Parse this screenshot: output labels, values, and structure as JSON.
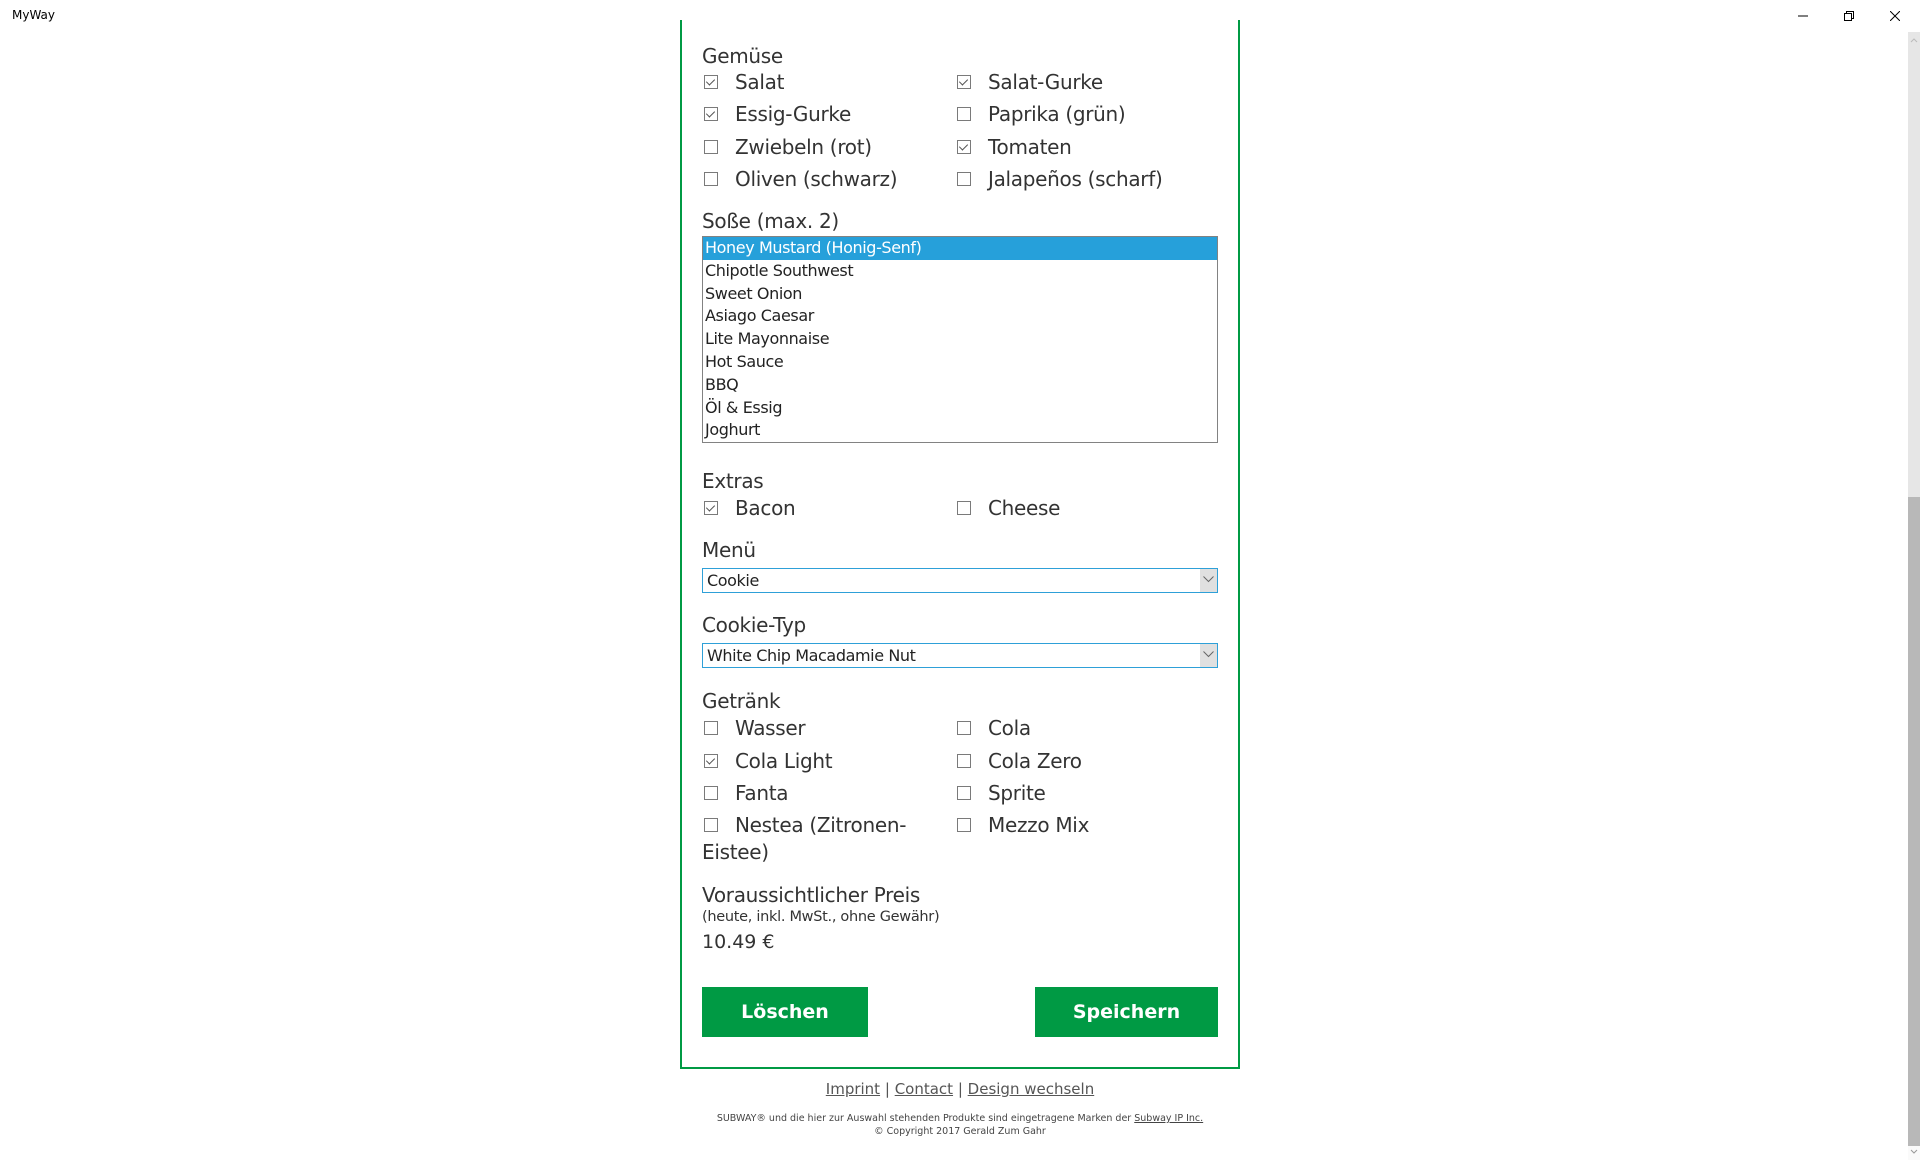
{
  "window": {
    "title": "MyWay",
    "controls": {
      "minimize": "—",
      "restore": "❐",
      "close": "✕"
    }
  },
  "vegetables": {
    "label": "Gemüse",
    "items": [
      {
        "label": "Salat",
        "checked": true
      },
      {
        "label": "Salat-Gurke",
        "checked": true
      },
      {
        "label": "Essig-Gurke",
        "checked": true
      },
      {
        "label": "Paprika (grün)",
        "checked": false
      },
      {
        "label": "Zwiebeln (rot)",
        "checked": false
      },
      {
        "label": "Tomaten",
        "checked": true
      },
      {
        "label": "Oliven (schwarz)",
        "checked": false
      },
      {
        "label": "Jalapeños (scharf)",
        "checked": false
      }
    ]
  },
  "sauce": {
    "label": "Soße (max. 2)",
    "options": [
      {
        "label": "Honey Mustard (Honig-Senf)",
        "selected": true
      },
      {
        "label": "Chipotle Southwest",
        "selected": false
      },
      {
        "label": "Sweet Onion",
        "selected": false
      },
      {
        "label": "Asiago Caesar",
        "selected": false
      },
      {
        "label": "Lite Mayonnaise",
        "selected": false
      },
      {
        "label": "Hot Sauce",
        "selected": false
      },
      {
        "label": "BBQ",
        "selected": false
      },
      {
        "label": "Öl & Essig",
        "selected": false
      },
      {
        "label": "Joghurt",
        "selected": false
      }
    ]
  },
  "extras": {
    "label": "Extras",
    "items": [
      {
        "label": "Bacon",
        "checked": true
      },
      {
        "label": "Cheese",
        "checked": false
      }
    ]
  },
  "menu": {
    "label": "Menü",
    "value": "Cookie"
  },
  "cookie_type": {
    "label": "Cookie-Typ",
    "value": "White Chip Macadamie Nut"
  },
  "drinks": {
    "label": "Getränk",
    "items": [
      {
        "label": "Wasser",
        "checked": false
      },
      {
        "label": "Cola",
        "checked": false
      },
      {
        "label": "Cola Light",
        "checked": true
      },
      {
        "label": "Cola Zero",
        "checked": false
      },
      {
        "label": "Fanta",
        "checked": false
      },
      {
        "label": "Sprite",
        "checked": false
      },
      {
        "label": "Nestea (Zitronen-",
        "label_line2": "Eistee)",
        "checked": false
      },
      {
        "label": "Mezzo Mix",
        "checked": false
      }
    ]
  },
  "price": {
    "label": "Voraussichtlicher Preis",
    "note": "(heute, inkl. MwSt., ohne Gewähr)",
    "value": "10.49 €"
  },
  "buttons": {
    "delete": "Löschen",
    "save": "Speichern"
  },
  "footer": {
    "links": [
      "Imprint",
      "Contact",
      "Design wechseln"
    ],
    "separator": "|",
    "trademark_text": "SUBWAY® und die hier zur Auswahl stehenden Produkte sind eingetragene Marken der ",
    "trademark_link": "Subway IP Inc.",
    "copyright": "© Copyright 2017 Gerald Zum Gahr"
  },
  "colors": {
    "brand_green": "#009a44",
    "selection_blue": "#26a0da",
    "focus_border": "#2ea0d8"
  }
}
